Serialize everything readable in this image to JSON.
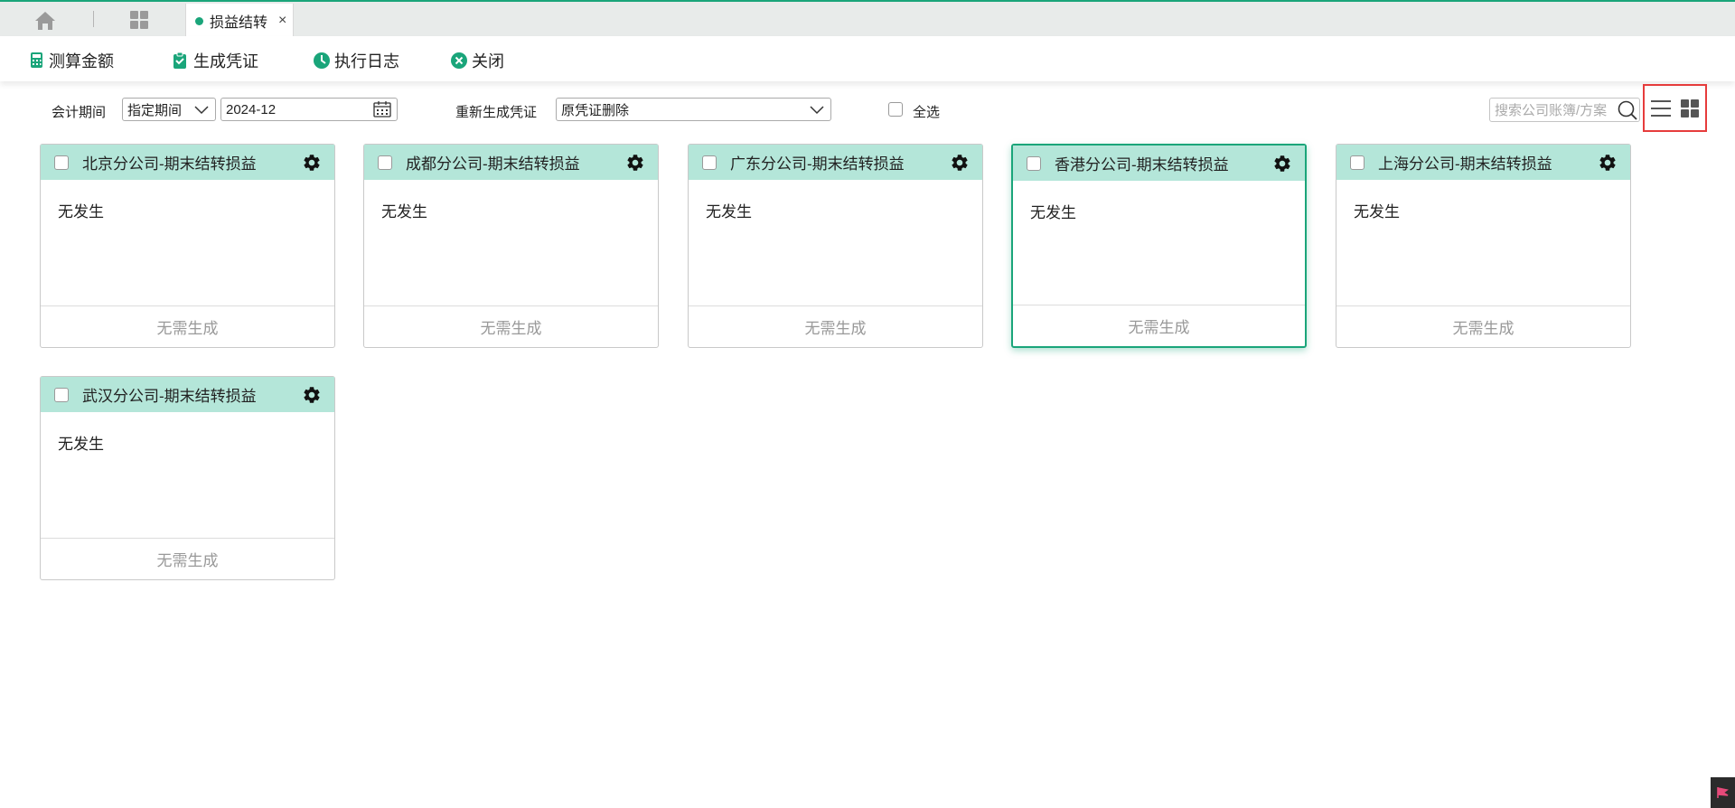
{
  "tabs": {
    "active": {
      "label": "损益结转",
      "close": "×"
    }
  },
  "toolbar": {
    "calc_label": "测算金额",
    "voucher_label": "生成凭证",
    "log_label": "执行日志",
    "close_label": "关闭"
  },
  "filters": {
    "period_label": "会计期间",
    "period_mode": "指定期间",
    "period_value": "2024-12",
    "regen_label": "重新生成凭证",
    "regen_value": "原凭证删除",
    "select_all_label": "全选",
    "search_placeholder": "搜索公司账簿/方案"
  },
  "cards": [
    {
      "title": "北京分公司-期末结转损益",
      "status": "无发生",
      "action": "无需生成"
    },
    {
      "title": "成都分公司-期末结转损益",
      "status": "无发生",
      "action": "无需生成"
    },
    {
      "title": "广东分公司-期末结转损益",
      "status": "无发生",
      "action": "无需生成"
    },
    {
      "title": "香港分公司-期末结转损益",
      "status": "无发生",
      "action": "无需生成"
    },
    {
      "title": "上海分公司-期末结转损益",
      "status": "无发生",
      "action": "无需生成"
    },
    {
      "title": "武汉分公司-期末结转损益",
      "status": "无发生",
      "action": "无需生成"
    }
  ],
  "colors": {
    "accent": "#1aa57a",
    "card_header": "#b4e6d9",
    "highlight_border": "#e63c3c"
  }
}
